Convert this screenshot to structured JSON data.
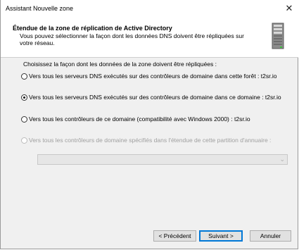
{
  "window": {
    "title": "Assistant Nouvelle zone",
    "close_glyph": "✕"
  },
  "header": {
    "title": "Étendue de la zone de réplication de Active Directory",
    "description": "Vous pouvez sélectionner la façon dont les données DNS doivent être répliquées sur votre réseau.",
    "icon": "server-icon"
  },
  "content": {
    "prompt": "Choisissez la façon dont les données de la zone doivent être répliquées :",
    "options": [
      {
        "label": "Vers tous les serveurs DNS exécutés sur des contrôleurs de domaine dans cette forêt : t2sr.io",
        "checked": false,
        "enabled": true
      },
      {
        "label": "Vers tous les serveurs DNS exécutés sur des contrôleurs de domaine dans ce domaine : t2sr.io",
        "checked": true,
        "enabled": true
      },
      {
        "label": "Vers tous les contrôleurs de ce domaine (compatibilité avec Windows 2000) : t2sr.io",
        "checked": false,
        "enabled": true
      },
      {
        "label": "Vers tous les contrôleurs de domaine spécifiés dans l'étendue de cette partition d'annuaire :",
        "checked": false,
        "enabled": false
      }
    ],
    "partition_select": {
      "value": "",
      "enabled": false
    }
  },
  "footer": {
    "back_label": "< Précédent",
    "next_label": "Suivant >",
    "cancel_label": "Annuler"
  },
  "colors": {
    "accent": "#0078d7",
    "dialog_bg": "#f0f0f0",
    "disabled_text": "#a0a0a0"
  }
}
